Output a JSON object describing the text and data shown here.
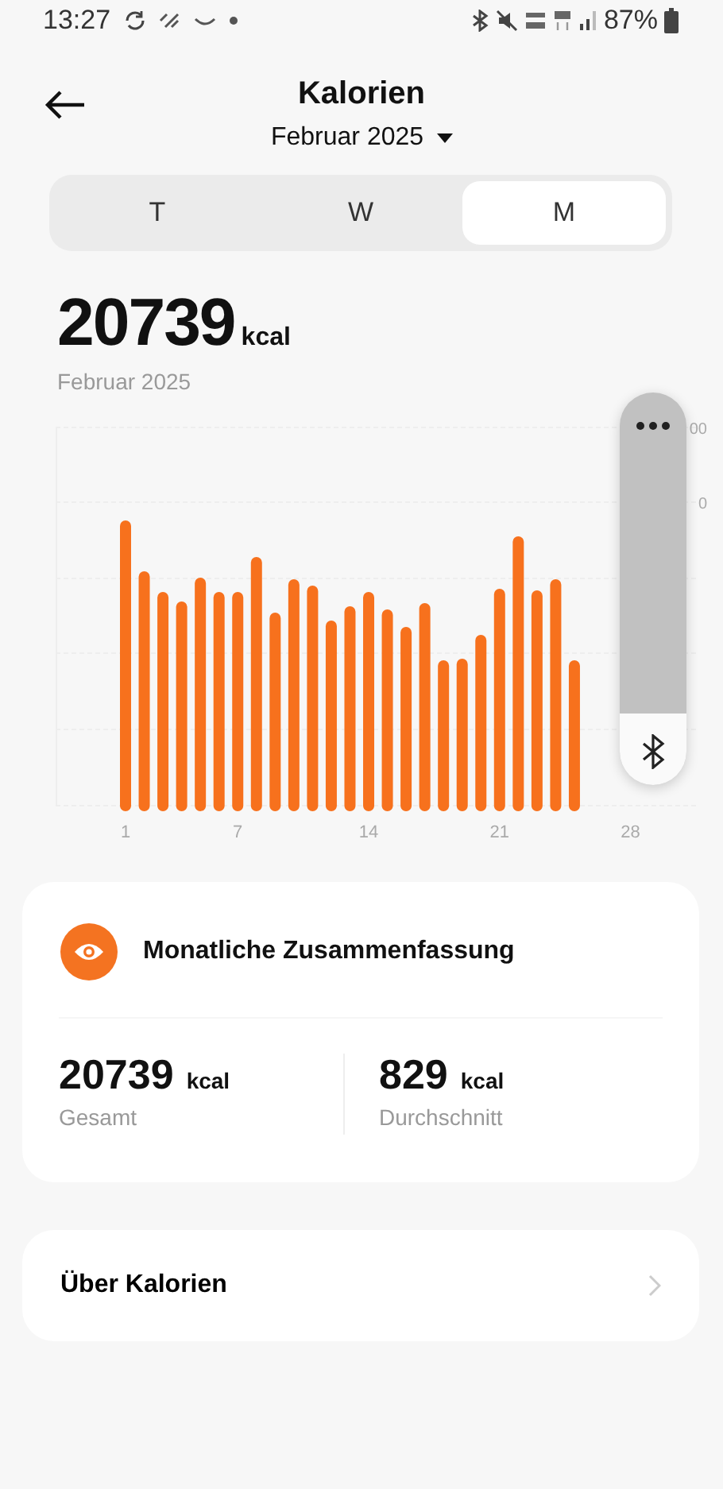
{
  "status_bar": {
    "time": "13:27",
    "battery": "87%"
  },
  "header": {
    "title": "Kalorien",
    "period": "Februar 2025"
  },
  "tabs": [
    {
      "label": "T",
      "selected": false
    },
    {
      "label": "W",
      "selected": false
    },
    {
      "label": "M",
      "selected": true
    }
  ],
  "total": {
    "value": "20739",
    "unit": "kcal",
    "caption": "Februar 2025"
  },
  "chart": {
    "kind": "picture",
    "x_labels": [
      "1",
      "7",
      "14",
      "21",
      "28"
    ],
    "y_labels_partial": [
      "00",
      "0"
    ]
  },
  "summary": {
    "title": "Monatliche Zusammenfassung",
    "stats": [
      {
        "value": "20739",
        "unit": "kcal",
        "label": "Gesamt"
      },
      {
        "value": "829",
        "unit": "kcal",
        "label": "Durchschnitt"
      }
    ]
  },
  "links": [
    {
      "label": "Über Kalorien"
    }
  ]
}
